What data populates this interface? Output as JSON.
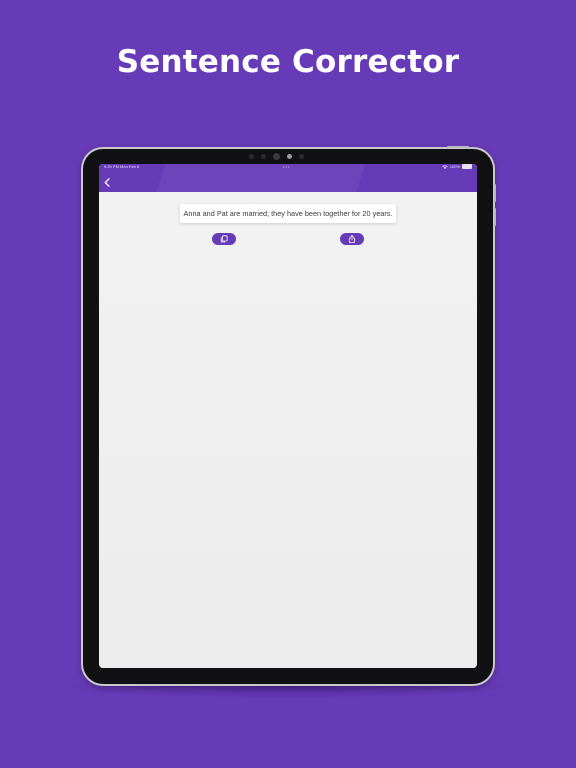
{
  "headline": "Sentence Corrector",
  "colors": {
    "background": "#673ab7",
    "accent": "#673ab7",
    "screen_background": "#efeff0"
  },
  "device": {
    "status_bar": {
      "time_date": "9:29 PM   Mon Feb 6",
      "center_dots": "• • •",
      "battery": "100%"
    }
  },
  "app": {
    "nav_bar": {
      "back_icon": "chevron-left-icon"
    },
    "corrected_sentence": "Anna and Pat are married; they have been together for 20 years.",
    "actions": [
      {
        "name": "copy",
        "icon": "copy-icon"
      },
      {
        "name": "share",
        "icon": "share-icon"
      }
    ]
  }
}
